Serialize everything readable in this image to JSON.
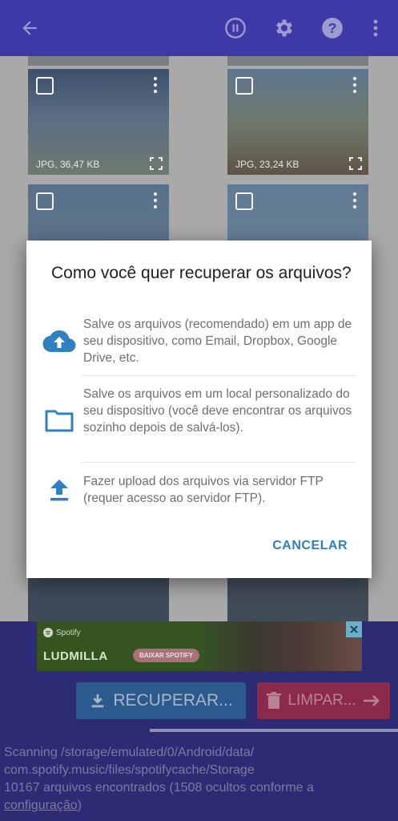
{
  "toolbar": {
    "icons": [
      "back-arrow-icon",
      "pause-icon",
      "gear-icon",
      "help-icon",
      "more-vert-icon"
    ]
  },
  "thumbnails": [
    {
      "meta": "JPG, 36,47 KB"
    },
    {
      "meta": "JPG, 23,24 KB"
    },
    {
      "meta": ""
    },
    {
      "meta": ""
    }
  ],
  "dialog": {
    "title": "Como você quer recuperar os arquivos?",
    "options": [
      {
        "icon": "cloud-upload-icon",
        "text": "Salve os arquivos (recomendado) em um app de seu dispositivo, como Email, Dropbox, Google Drive, etc."
      },
      {
        "icon": "folder-icon",
        "text": "Salve os arquivos em um local personalizado do seu dispositivo (você deve encontrar os arquivos sozinho depois de salvá-los)."
      },
      {
        "icon": "upload-icon",
        "text": "Fazer upload dos arquivos via servidor FTP (requer acesso ao servidor FTP)."
      }
    ],
    "cancel_label": "CANCELAR"
  },
  "ad": {
    "brand": "Spotify",
    "artist": "LUDMILLA",
    "cta": "BAIXAR SPOTIFY"
  },
  "actions": {
    "recover_label": "RECUPERAR...",
    "clean_label": "LIMPAR..."
  },
  "status": {
    "line1": "Scanning /storage/emulated/0/Android/data/",
    "line2": "com.spotify.music/files/spotifycache/Storage",
    "line3": "10167 arquivos encontrados (1508 ocultos conforme a",
    "link": "configuração",
    "tail": ")"
  },
  "colors": {
    "toolbar": "#3d3aa8",
    "accent": "#2f7fc1",
    "recover": "#2a5a8e",
    "clean": "#8c2a4a"
  }
}
